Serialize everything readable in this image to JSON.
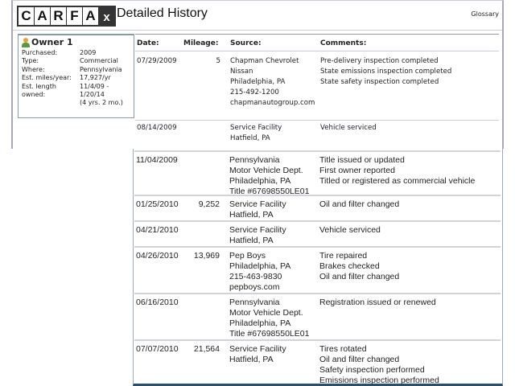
{
  "header": {
    "logo": "CARFAX",
    "title": "Detailed History",
    "glossary": "Glossary"
  },
  "owner": {
    "title": "Owner 1",
    "fields": [
      {
        "k": "Purchased:",
        "v": "2009"
      },
      {
        "k": "Type:",
        "v": "Commercial"
      },
      {
        "k": "Where:",
        "v": "Pennsylvania"
      },
      {
        "k": "Est. miles/year:",
        "v": "17,927/yr"
      },
      {
        "k": "Est. length",
        "v": "11/4/09 -"
      },
      {
        "k": "owned:",
        "v": "1/20/14"
      },
      {
        "k": "",
        "v": "(4 yrs. 2 mo.)"
      }
    ]
  },
  "columns": {
    "date": "Date:",
    "mileage": "Mileage:",
    "source": "Source:",
    "comments": "Comments:"
  },
  "records": [
    {
      "date": "07/29/2009",
      "mileage": "5",
      "source": [
        "Chapman Chevrolet",
        "Nissan",
        "Philadelphia, PA",
        "215-492-1200",
        "chapmanautogroup.com"
      ],
      "comments": [
        "Pre-delivery inspection completed",
        "State emissions inspection completed",
        "State safety inspection completed"
      ]
    },
    {
      "date": "08/14/2009",
      "mileage": "",
      "source": [
        "Service Facility",
        "Hatfield, PA"
      ],
      "comments": [
        "Vehicle serviced"
      ]
    },
    {
      "date": "11/04/2009",
      "mileage": "",
      "source": [
        "Pennsylvania",
        "Motor Vehicle Dept.",
        "Philadelphia, PA",
        "Title #67698550LE01"
      ],
      "comments": [
        "Title issued or updated",
        "First owner reported",
        "Titled or registered as commercial vehicle"
      ]
    },
    {
      "date": "01/25/2010",
      "mileage": "9,252",
      "source": [
        "Service Facility",
        "Hatfield, PA"
      ],
      "comments": [
        "Oil and filter changed"
      ]
    },
    {
      "date": "04/21/2010",
      "mileage": "",
      "source": [
        "Service Facility",
        "Hatfield, PA"
      ],
      "comments": [
        "Vehicle serviced"
      ]
    },
    {
      "date": "04/26/2010",
      "mileage": "13,969",
      "source": [
        "Pep Boys",
        "Philadelphia, PA",
        "215-463-9830",
        "pepboys.com"
      ],
      "comments": [
        "Tire repaired",
        "Brakes checked",
        "Oil and filter changed"
      ]
    },
    {
      "date": "06/16/2010",
      "mileage": "",
      "source": [
        "Pennsylvania",
        "Motor Vehicle Dept.",
        "Philadelphia, PA",
        "Title #67698550LE01"
      ],
      "comments": [
        "Registration issued or renewed"
      ]
    },
    {
      "date": "07/07/2010",
      "mileage": "21,564",
      "source": [
        "Service Facility",
        "Hatfield, PA"
      ],
      "comments": [
        "Tires rotated",
        "Oil and filter changed",
        "Safety inspection performed",
        "Emissions inspection performed"
      ]
    }
  ]
}
